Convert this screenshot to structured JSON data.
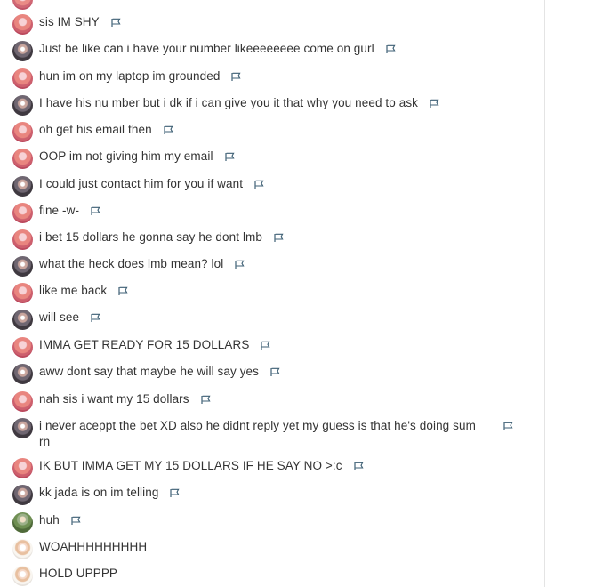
{
  "messages": [
    {
      "text": "sis IM SHY",
      "avatar": "pink",
      "flag": true
    },
    {
      "text": "Just be like can i have your number likeeeeeeee come on gurl",
      "avatar": "dark",
      "flag": true
    },
    {
      "text": "hun im on my laptop im grounded",
      "avatar": "pink",
      "flag": true
    },
    {
      "text": "I have his nu mber but i dk if i can give you it that why you need to ask",
      "avatar": "dark",
      "flag": true
    },
    {
      "text": "oh get his email then",
      "avatar": "pink",
      "flag": true
    },
    {
      "text": "OOP im not giving him my email",
      "avatar": "pink",
      "flag": true
    },
    {
      "text": "I could just contact him for you if want",
      "avatar": "dark",
      "flag": true
    },
    {
      "text": "fine -w-",
      "avatar": "pink",
      "flag": true
    },
    {
      "text": "i bet 15 dollars he gonna say he dont lmb",
      "avatar": "pink",
      "flag": true
    },
    {
      "text": "what the heck does lmb mean? lol",
      "avatar": "dark",
      "flag": true
    },
    {
      "text": "like me back",
      "avatar": "pink",
      "flag": true
    },
    {
      "text": "will see",
      "avatar": "dark",
      "flag": true
    },
    {
      "text": "IMMA GET READY FOR 15 DOLLARS",
      "avatar": "pink",
      "flag": true
    },
    {
      "text": "aww dont say that maybe he will say yes",
      "avatar": "dark",
      "flag": true
    },
    {
      "text": "nah sis i want my 15 dollars",
      "avatar": "pink",
      "flag": true
    },
    {
      "text": "i never aceppt the bet XD also he didnt reply yet my guess is that he's doing sum rn",
      "avatar": "dark",
      "flag": true
    },
    {
      "text": "IK BUT IMMA GET MY 15 DOLLARS IF HE SAY NO >:c",
      "avatar": "pink",
      "flag": true
    },
    {
      "text": "kk jada is on im telling",
      "avatar": "dark",
      "flag": true
    },
    {
      "text": "huh",
      "avatar": "green",
      "flag": true
    },
    {
      "text": "WOAHHHHHHHHH",
      "avatar": "sketch",
      "flag": false
    },
    {
      "text": "HOLD UPPPP",
      "avatar": "sketch",
      "flag": false
    }
  ],
  "icons": {
    "flag": "flag-icon"
  }
}
